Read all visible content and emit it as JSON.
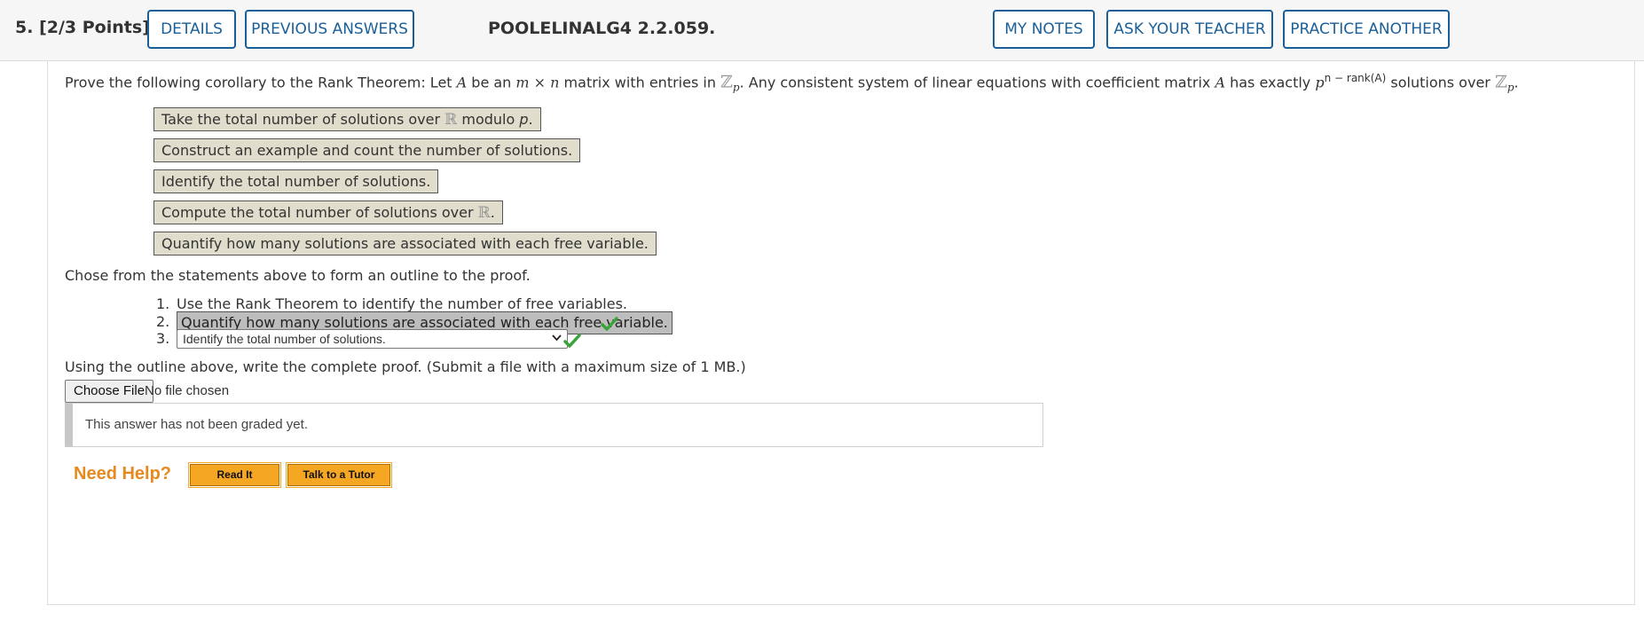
{
  "header": {
    "question_number": "5.",
    "points": "[2/3 Points]",
    "buttons": {
      "details": "DETAILS",
      "previous_answers": "PREVIOUS ANSWERS",
      "my_notes": "MY NOTES",
      "ask_teacher": "ASK YOUR TEACHER",
      "practice_another": "PRACTICE ANOTHER"
    },
    "question_id": "POOLELINALG4 2.2.059."
  },
  "prompt": {
    "part1": "Prove the following corollary to the Rank Theorem: Let ",
    "var_A": "A",
    "part2": " be an ",
    "dims": "m × n",
    "part3": " matrix with entries in ",
    "field": "ℤ",
    "field_sub": "p",
    "part4": ". Any consistent system of linear equations with coefficient matrix ",
    "var_A2": "A",
    "part5": " has exactly ",
    "base": "p",
    "exponent": "n − rank(A)",
    "part6": " solutions over ",
    "field2": "ℤ",
    "field2_sub": "p",
    "end": "."
  },
  "tiles": [
    {
      "text_before": "Take the total number of solutions over ",
      "symbol": "ℝ",
      "text_after": " modulo ",
      "var": "p",
      "end": "."
    },
    {
      "text": "Construct an example and count the number of solutions."
    },
    {
      "text": "Identify the total number of solutions."
    },
    {
      "text_before": "Compute the total number of solutions over ",
      "symbol": "ℝ",
      "end": "."
    },
    {
      "text": "Quantify how many solutions are associated with each free variable."
    }
  ],
  "outline_instruction": "Chose from the statements above to form an outline to the proof.",
  "outline": {
    "item1_num": "1.",
    "item1_text": "Use the Rank Theorem to identify the number of free variables.",
    "item2_num": "2.",
    "item2_value": "Quantify how many solutions are associated with each free variable.",
    "item3_num": "3.",
    "item3_selected": "Identify the total number of solutions."
  },
  "proof_instruction": "Using the outline above, write the complete proof. (Submit a file with a maximum size of 1 MB.)",
  "file_upload": {
    "button_label": "Choose File",
    "status": "No file chosen"
  },
  "grading_status": "This answer has not been graded yet.",
  "help": {
    "label": "Need Help?",
    "read_it": "Read It",
    "talk_to_tutor": "Talk to a Tutor"
  },
  "colors": {
    "accent_blue": "#1a5f99",
    "tile_bg": "#e0ddcc",
    "check_green": "#3aa33a",
    "help_orange": "#e68a1f"
  }
}
